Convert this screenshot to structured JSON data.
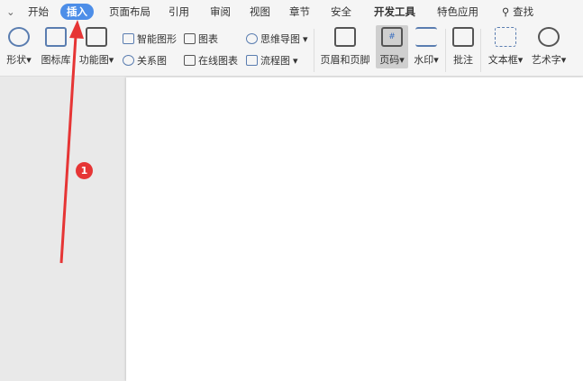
{
  "menu": {
    "collapse": "⌄",
    "tabs": [
      "开始",
      "插入",
      "页面布局",
      "引用",
      "审阅",
      "视图",
      "章节",
      "安全",
      "开发工具",
      "特色应用"
    ],
    "active": "插入",
    "search": "查找"
  },
  "ribbon": {
    "shape": "形状",
    "icon_lib": "图标库",
    "func_chart": "功能图",
    "smart_art": "智能图形",
    "chart": "图表",
    "mind_map": "思维导图",
    "relation": "关系图",
    "online_chart": "在线图表",
    "flowchart": "流程图",
    "header_footer": "页眉和页脚",
    "page_number": "页码",
    "watermark": "水印",
    "comment": "批注",
    "text_box": "文本框",
    "word_art": "艺术字"
  },
  "annotation": {
    "step": "1",
    "color": "#e63535"
  }
}
